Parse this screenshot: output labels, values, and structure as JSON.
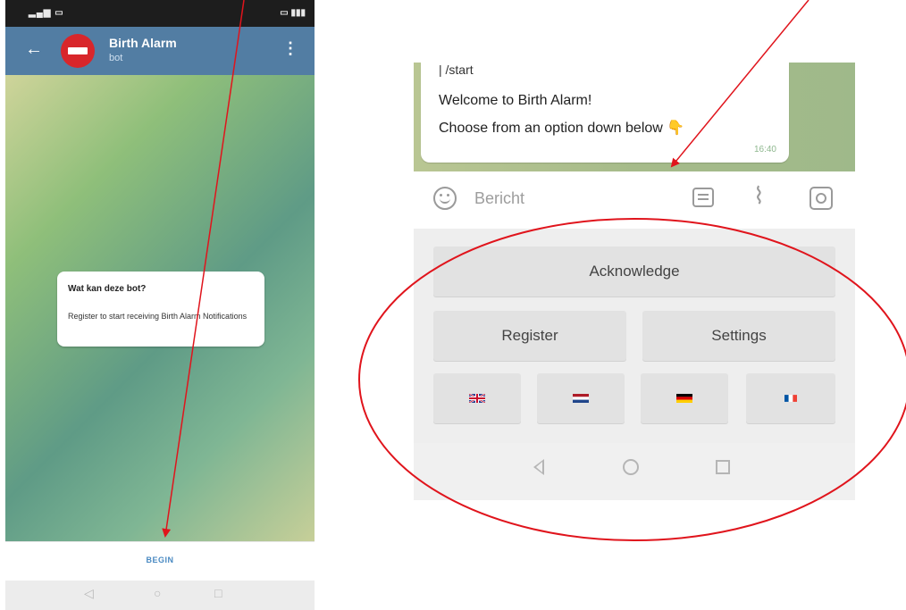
{
  "left_phone": {
    "header": {
      "title": "Birth Alarm",
      "subtitle": "bot"
    },
    "info_card": {
      "question": "Wat kan deze bot?",
      "answer": "Register to start receiving Birth Alarm Notifications"
    },
    "begin_label": "BEGIN",
    "nav": {
      "back": "◁",
      "home": "○",
      "recent": "□"
    }
  },
  "right_phone": {
    "message": {
      "command": "| /start",
      "line1": "Welcome to Birth Alarm!",
      "line2": "Choose from an option down below",
      "emoji": "👇",
      "time": "16:40"
    },
    "input": {
      "placeholder": "Bericht"
    },
    "keyboard": {
      "acknowledge": "Acknowledge",
      "register": "Register",
      "settings": "Settings",
      "flags": [
        "flag-uk",
        "flag-netherlands",
        "flag-germany",
        "flag-france"
      ]
    }
  },
  "colors": {
    "header_blue": "#527da3",
    "avatar_red": "#d8262b",
    "annotation_red": "#e0141c",
    "link_blue": "#4a8ac2"
  }
}
